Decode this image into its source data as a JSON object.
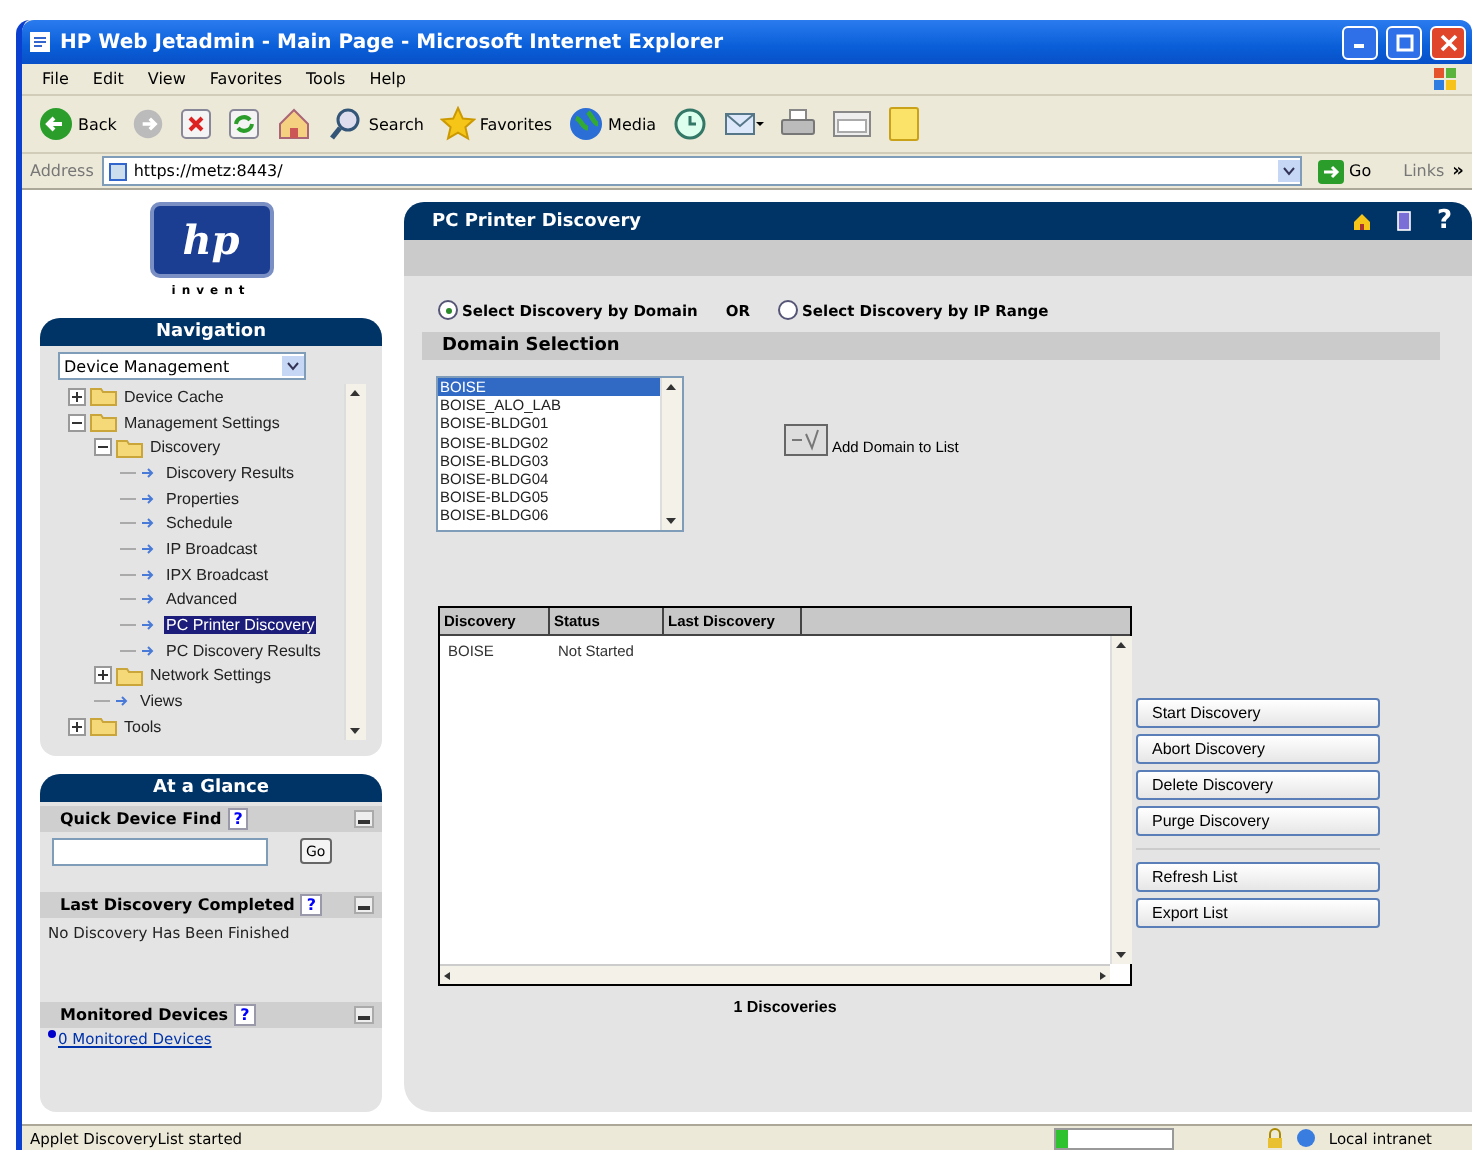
{
  "window": {
    "title": "HP Web Jetadmin - Main Page - Microsoft Internet Explorer"
  },
  "menu": [
    "File",
    "Edit",
    "View",
    "Favorites",
    "Tools",
    "Help"
  ],
  "toolbar": [
    {
      "kind": "back",
      "label": "Back"
    },
    {
      "kind": "forward"
    },
    {
      "kind": "stop"
    },
    {
      "kind": "refresh"
    },
    {
      "kind": "home"
    },
    {
      "kind": "search",
      "label": "Search"
    },
    {
      "kind": "favorites",
      "label": "Favorites"
    },
    {
      "kind": "media",
      "label": "Media"
    },
    {
      "kind": "history"
    },
    {
      "kind": "mail"
    },
    {
      "kind": "print"
    },
    {
      "kind": "edit"
    },
    {
      "kind": "note"
    }
  ],
  "address": {
    "label": "Address",
    "value": "https://metz:8443/",
    "go": "Go",
    "links": "Links",
    "more": "»"
  },
  "logo": {
    "mark": "hp",
    "caption": "invent"
  },
  "navigation": {
    "title": "Navigation",
    "view": "Device Management",
    "tree": [
      {
        "label": "Device Cache",
        "kind": "folder",
        "expanded": false,
        "selected": false
      },
      {
        "label": "Management Settings",
        "kind": "folder",
        "expanded": true,
        "selected": false,
        "children": [
          {
            "label": "Discovery",
            "kind": "folder",
            "expanded": true,
            "selected": false,
            "children": [
              {
                "label": "Discovery Results",
                "kind": "page",
                "selected": false
              },
              {
                "label": "Properties",
                "kind": "page",
                "selected": false
              },
              {
                "label": "Schedule",
                "kind": "page",
                "selected": false
              },
              {
                "label": "IP Broadcast",
                "kind": "page",
                "selected": false
              },
              {
                "label": "IPX Broadcast",
                "kind": "page",
                "selected": false
              },
              {
                "label": "Advanced",
                "kind": "page",
                "selected": false
              },
              {
                "label": "PC Printer Discovery",
                "kind": "page",
                "selected": true
              },
              {
                "label": "PC Discovery Results",
                "kind": "page",
                "selected": false
              }
            ]
          },
          {
            "label": "Network Settings",
            "kind": "folder",
            "expanded": false,
            "selected": false
          },
          {
            "label": "Views",
            "kind": "page",
            "selected": false
          }
        ]
      },
      {
        "label": "Tools",
        "kind": "folder",
        "expanded": false,
        "selected": false
      }
    ]
  },
  "at_a_glance": {
    "title": "At a Glance",
    "sections": [
      {
        "kind": "search",
        "title": "Quick Device Find",
        "help": "?",
        "button": "Go"
      },
      {
        "kind": "text",
        "title": "Last Discovery Completed",
        "help": "?",
        "text": "No Discovery Has Been Finished"
      },
      {
        "kind": "link",
        "title": "Monitored Devices",
        "help": "?",
        "text": "0 Monitored Devices"
      }
    ]
  },
  "panel": {
    "title": "PC Printer Discovery",
    "help": "?",
    "modes": [
      {
        "label": "Select Discovery by Domain",
        "selected": true
      },
      {
        "label": "Select Discovery by IP Range",
        "selected": false
      }
    ],
    "or": "OR",
    "domain_selection": {
      "title": "Domain Selection",
      "add_button": "Add Domain to List",
      "domains": [
        {
          "name": "BOISE",
          "selected": true
        },
        {
          "name": "BOISE_ALO_LAB",
          "selected": false
        },
        {
          "name": "BOISE-BLDG01",
          "selected": false
        },
        {
          "name": "BOISE-BLDG02",
          "selected": false
        },
        {
          "name": "BOISE-BLDG03",
          "selected": false
        },
        {
          "name": "BOISE-BLDG04",
          "selected": false
        },
        {
          "name": "BOISE-BLDG05",
          "selected": false
        },
        {
          "name": "BOISE-BLDG06",
          "selected": false
        }
      ]
    },
    "discoveries": {
      "columns": [
        "Discovery",
        "Status",
        "Last Discovery"
      ],
      "rows": [
        {
          "discovery": "BOISE",
          "status": "Not Started"
        }
      ],
      "count": "1 Discoveries"
    },
    "action_groups": [
      [
        "Start Discovery",
        "Abort Discovery",
        "Delete Discovery",
        "Purge Discovery"
      ],
      [
        "Refresh List",
        "Export List"
      ]
    ]
  },
  "status_bar": {
    "text": "Applet DiscoveryList started",
    "progress": {
      "level": 0.1
    },
    "zone": "Local intranet"
  }
}
